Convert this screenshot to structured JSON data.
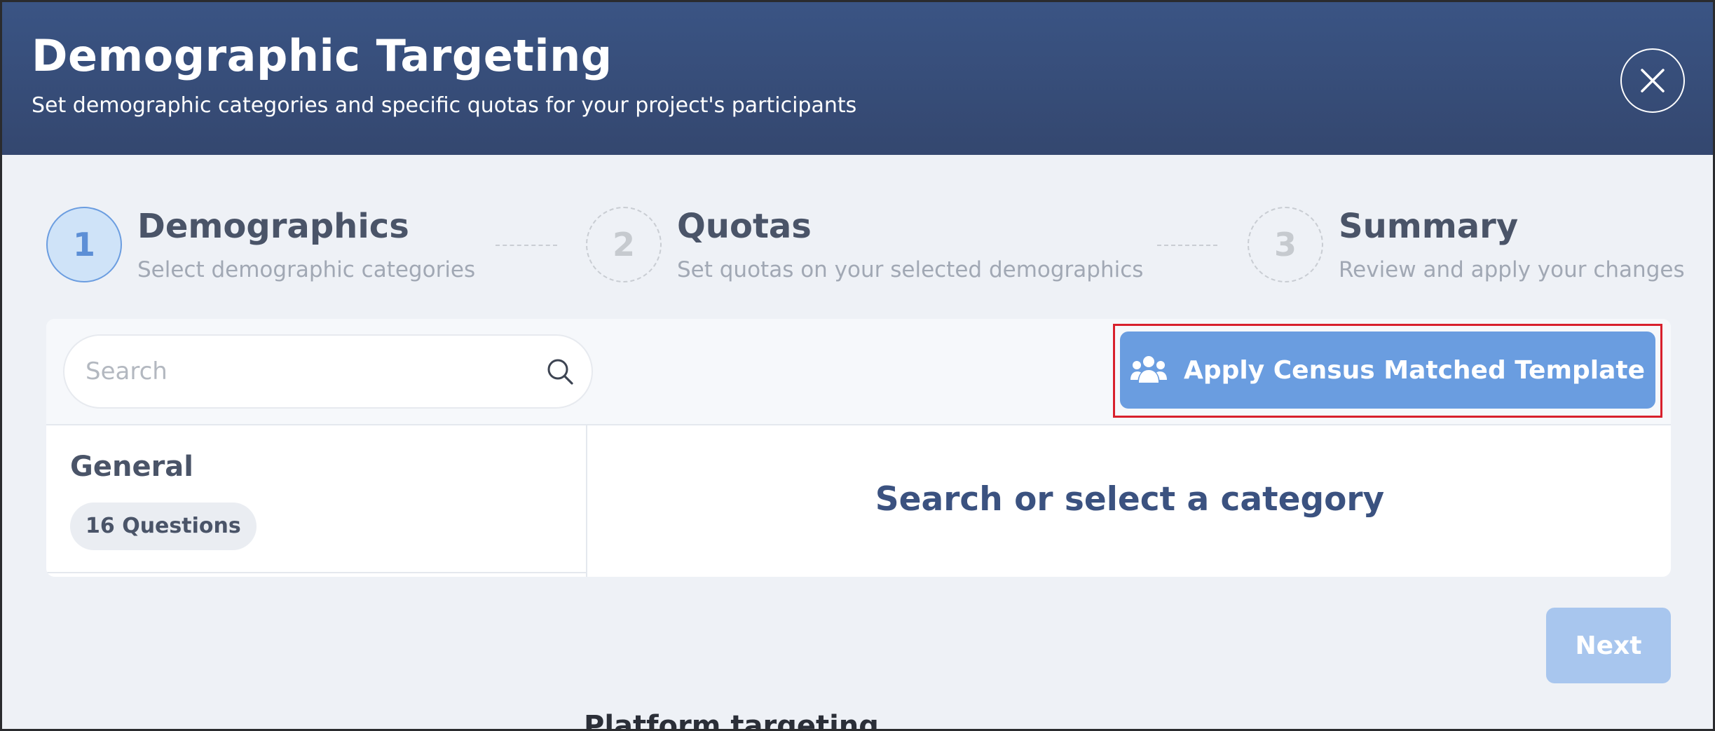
{
  "header": {
    "title": "Demographic Targeting",
    "subtitle": "Set demographic categories and specific quotas for your project's participants",
    "close_icon": "close-icon"
  },
  "steps": [
    {
      "number": "1",
      "title": "Demographics",
      "description": "Select demographic categories",
      "state": "active"
    },
    {
      "number": "2",
      "title": "Quotas",
      "description": "Set quotas on your selected demographics",
      "state": "inactive"
    },
    {
      "number": "3",
      "title": "Summary",
      "description": "Review and apply your changes",
      "state": "inactive"
    }
  ],
  "search": {
    "placeholder": "Search",
    "value": "",
    "icon": "search-icon"
  },
  "census_button": {
    "label": "Apply Census Matched Template",
    "icon": "users-icon"
  },
  "categories": [
    {
      "name": "General",
      "count_label": "16 Questions"
    }
  ],
  "empty_state": "Search or select a category",
  "next_button": {
    "label": "Next",
    "enabled": false
  },
  "background_peek": "Platform targeting",
  "colors": {
    "header": "#3a5484",
    "accent": "#6a9de0",
    "highlight": "#d8202c",
    "disabled_button": "#a8c6ee"
  }
}
